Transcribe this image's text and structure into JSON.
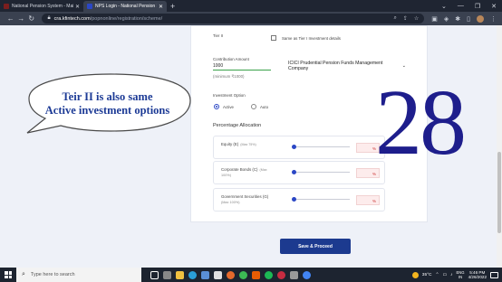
{
  "browser": {
    "tabs": [
      {
        "label": "National Pension System - Main...",
        "active": false,
        "color": "#7b1e1e"
      },
      {
        "label": "NPS Login - National Pension S...",
        "active": true,
        "color": "#2b47c5"
      }
    ],
    "new_tab_symbol": "+",
    "url_host": "cra.kfintech.com",
    "url_path": "/popnonline/registration/scheme/",
    "window_controls": [
      "⌄",
      "—",
      "❐",
      "✕"
    ]
  },
  "form": {
    "tier_label": "Tier II",
    "same_as_tier1_label": "Same as Tier I Investment details",
    "contribution_label": "Contribution Amount",
    "contribution_value": "1000",
    "minimum_label": "(minimum ₹1000)",
    "pfm_selected": "ICICI Prudential Pension Funds Management Company",
    "investment_option_label": "Investment Option",
    "options": [
      {
        "label": "Active",
        "selected": true
      },
      {
        "label": "Auto",
        "selected": false
      }
    ],
    "allocation_title": "Percentage Allocation",
    "allocations": [
      {
        "name": "Equity (E)",
        "max": "(Max 75%)",
        "sub": "",
        "value": "%",
        "fill": 0
      },
      {
        "name": "Corporate Bonds (C)",
        "max": "(Max",
        "sub": "100%)",
        "value": "%",
        "fill": 0
      },
      {
        "name": "Government Securities (G)",
        "max": "",
        "sub": "(Max 100%)",
        "value": "%",
        "fill": 0
      }
    ],
    "save_button": "Save & Proceed"
  },
  "overlay": {
    "callout": [
      "Teir II is also same",
      "Active investment options"
    ],
    "number": "28"
  },
  "taskbar": {
    "search_placeholder": "Type here to search",
    "temperature": "35°C",
    "language_top": "ENG",
    "language_bottom": "IN",
    "time": "5:46 PM",
    "date": "4/26/2022"
  },
  "colors": {
    "accent": "#2b47c5",
    "button": "#1c3a8f",
    "callout_text": "#1d3b96",
    "big_number": "#1e1e8c"
  }
}
